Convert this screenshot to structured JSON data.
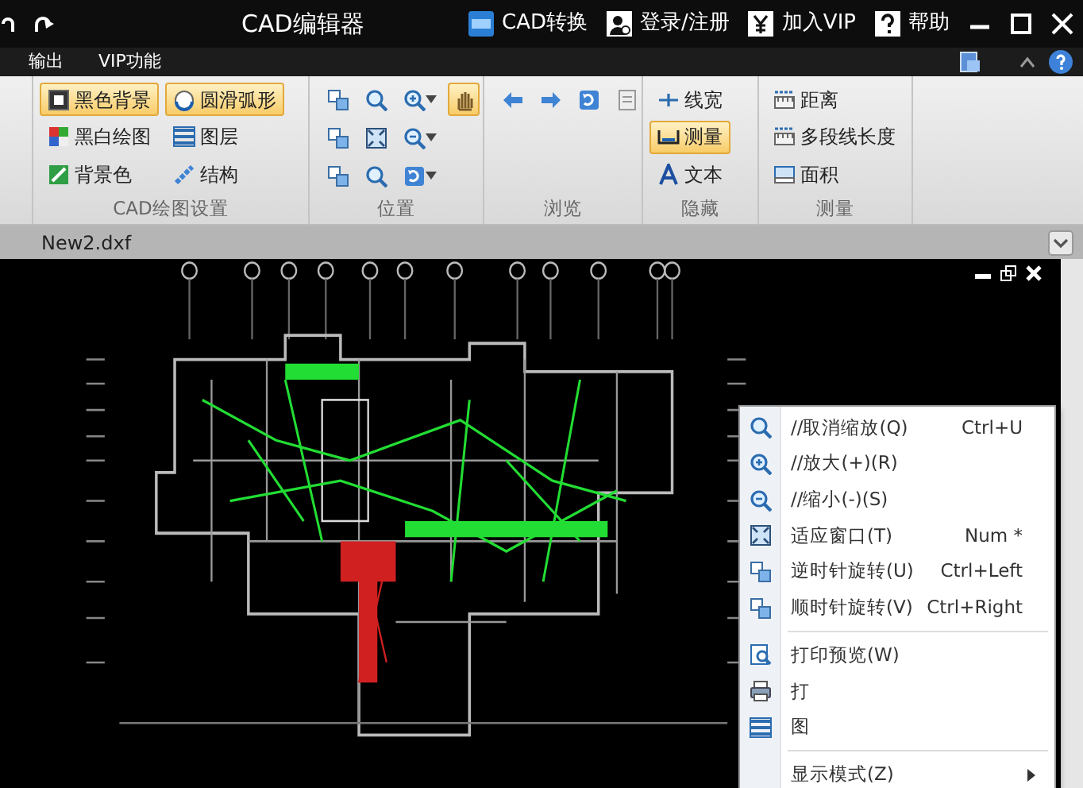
{
  "title_bar": {
    "app_title": "CAD编辑器",
    "actions": [
      {
        "label": "CAD转换"
      },
      {
        "label": "登录/注册"
      },
      {
        "label": "加入VIP"
      },
      {
        "label": "帮助"
      }
    ]
  },
  "ribbon_tabs": [
    {
      "label": "输出"
    },
    {
      "label": "VIP功能"
    }
  ],
  "ribbon_groups": [
    {
      "title": "CAD绘图设置",
      "kind": "list",
      "items": [
        {
          "label": "黑色背景",
          "highlighted": true
        },
        {
          "label": "圆滑弧形",
          "highlighted": true
        },
        {
          "label": "黑白绘图",
          "highlighted": false
        },
        {
          "label": "图层",
          "highlighted": false
        },
        {
          "label": "背景色",
          "highlighted": false
        },
        {
          "label": "结构",
          "highlighted": false
        }
      ]
    },
    {
      "title": "位置",
      "kind": "grid",
      "items": [
        {
          "highlighted": false
        },
        {
          "highlighted": false
        },
        {
          "highlighted": false
        },
        {
          "highlighted": true
        },
        {
          "highlighted": false
        },
        {
          "highlighted": false
        },
        {
          "highlighted": false
        },
        {
          "highlighted": false
        },
        {
          "highlighted": false
        },
        {
          "highlighted": false
        }
      ]
    },
    {
      "title": "浏览",
      "kind": "row",
      "items": [
        {
          "highlighted": false
        },
        {
          "highlighted": false
        },
        {
          "highlighted": false
        },
        {
          "highlighted": false
        }
      ]
    },
    {
      "title": "隐藏",
      "kind": "list",
      "items": [
        {
          "label": "线宽",
          "highlighted": false
        },
        {
          "label": "测量",
          "highlighted": true
        },
        {
          "label": "文本",
          "highlighted": false
        }
      ]
    },
    {
      "title": "测量",
      "kind": "list",
      "items": [
        {
          "label": "距离",
          "highlighted": false
        },
        {
          "label": "多段线长度",
          "highlighted": false
        },
        {
          "label": "面积",
          "highlighted": false
        }
      ]
    }
  ],
  "document_tab": {
    "label": "New2.dxf"
  },
  "context_menu": [
    {
      "kind": "item",
      "label": "//取消缩放(Q)",
      "shortcut": "Ctrl+U"
    },
    {
      "kind": "item",
      "label": "//放大(+)(R)"
    },
    {
      "kind": "item",
      "label": "//缩小(-)(S)"
    },
    {
      "kind": "item",
      "label": "适应窗口(T)",
      "shortcut": "Num *"
    },
    {
      "kind": "item",
      "label": "逆时针旋转(U)",
      "shortcut": "Ctrl+Left"
    },
    {
      "kind": "item",
      "label": "顺时针旋转(V)",
      "shortcut": "Ctrl+Right"
    },
    {
      "kind": "separator"
    },
    {
      "kind": "item",
      "label": "打印预览(W)"
    },
    {
      "kind": "item",
      "label": "打"
    },
    {
      "kind": "item",
      "label": "图"
    },
    {
      "kind": "separator"
    },
    {
      "kind": "submenu",
      "label": "显示模式(Z)"
    }
  ]
}
